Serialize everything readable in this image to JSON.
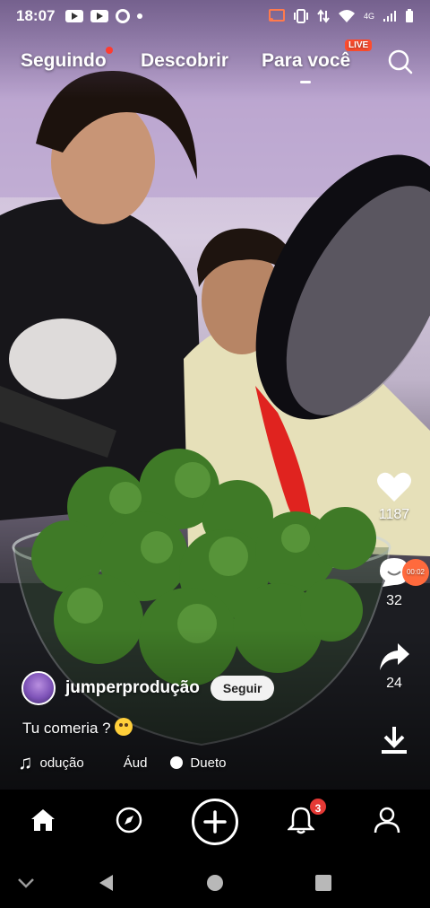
{
  "status_bar": {
    "time": "18:07",
    "network": "4G"
  },
  "top_tabs": {
    "items": [
      {
        "label": "Seguindo"
      },
      {
        "label": "Descobrir",
        "badge": "LIVE"
      },
      {
        "label": "Para você",
        "active": true
      }
    ]
  },
  "actions": {
    "likes": "1187",
    "comments": "32",
    "shares": "24",
    "timer": "00:02"
  },
  "post": {
    "username": "jumperprodução",
    "follow_label": "Seguir",
    "caption": "Tu comeria ?",
    "music_segment_1": "odução",
    "music_segment_2": "Áud",
    "dueto_label": "Dueto"
  },
  "bottom_nav": {
    "items": [
      "home-icon",
      "compass-icon",
      "plus-icon",
      "bell-icon",
      "user-icon"
    ],
    "notification_count": "3"
  },
  "colors": {
    "accent": "#ff4d2e",
    "badge": "#e53935",
    "nav_bg": "#000000"
  }
}
